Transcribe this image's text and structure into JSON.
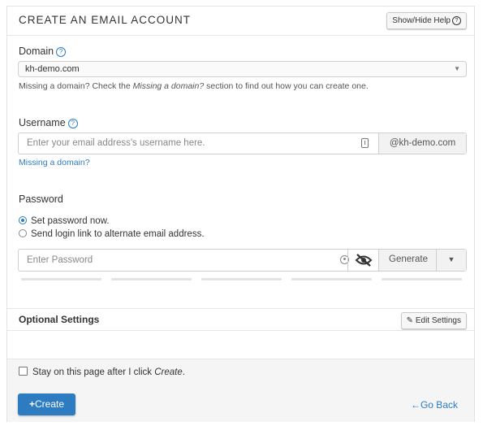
{
  "header": {
    "title": "CREATE AN EMAIL ACCOUNT",
    "help_button": "Show/Hide Help",
    "help_icon_glyph": "?"
  },
  "domain": {
    "label": "Domain",
    "help_glyph": "?",
    "selected": "kh-demo.com",
    "hint_prefix": "Missing a domain? Check the ",
    "hint_emph": "Missing a domain?",
    "hint_suffix": " section to find out how you can create one."
  },
  "username": {
    "label": "Username",
    "help_glyph": "?",
    "placeholder": "Enter your email address's username here.",
    "suffix": "@kh-demo.com",
    "link": "Missing a domain?"
  },
  "password": {
    "label": "Password",
    "options": [
      {
        "label": "Set password now.",
        "checked": true
      },
      {
        "label": "Send login link to alternate email address.",
        "checked": false
      }
    ],
    "placeholder": "Enter Password",
    "generate": "Generate",
    "strength_segments": 5
  },
  "optional": {
    "title": "Optional Settings",
    "edit_button": "Edit Settings"
  },
  "footer": {
    "stay_prefix": "Stay on this page after I click ",
    "stay_emph": "Create",
    "stay_suffix": ".",
    "create": "Create",
    "go_back": "Go Back"
  },
  "colors": {
    "accent": "#2d7cc1",
    "border": "#cfcfcf",
    "section_bg": "#f5f5f5"
  }
}
